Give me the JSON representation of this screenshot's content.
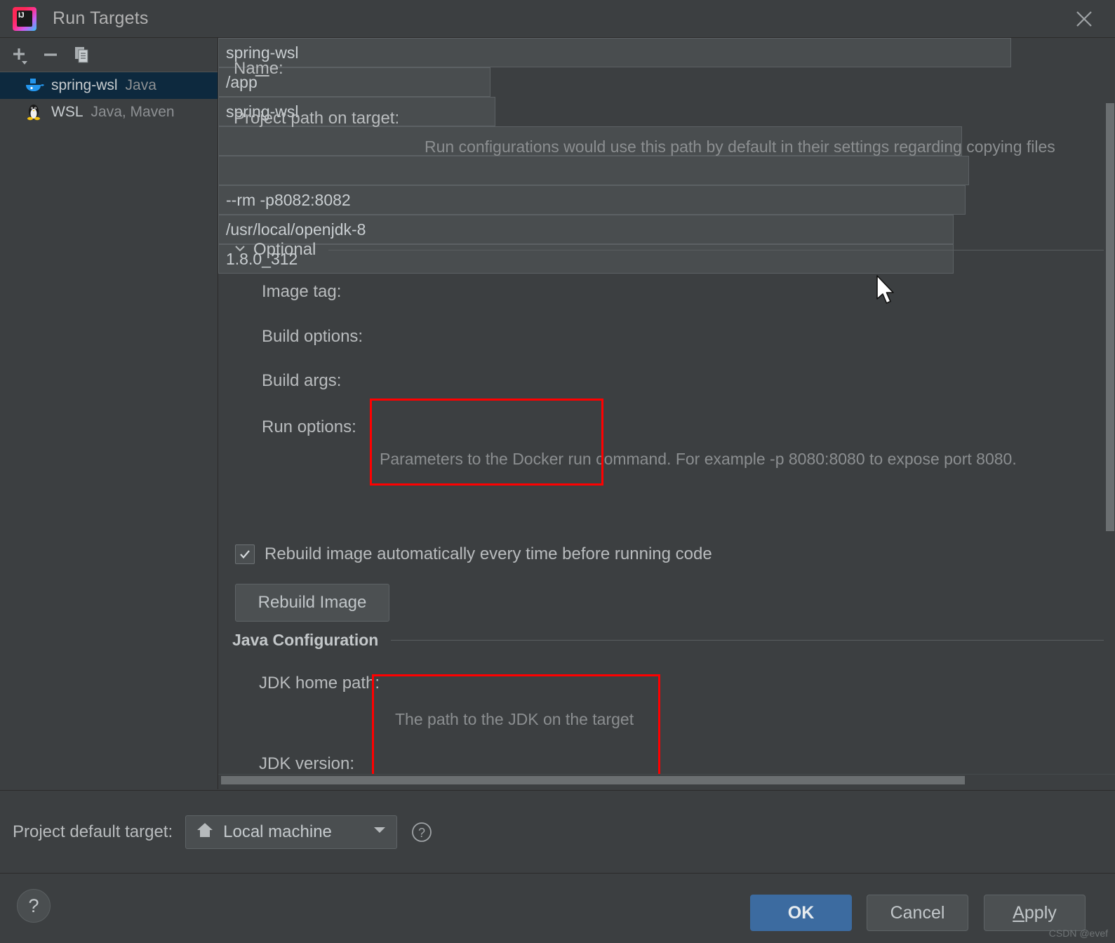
{
  "window": {
    "title": "Run Targets",
    "app_icon": "intellij-idea-icon",
    "close_icon": "close-icon"
  },
  "sidebar": {
    "toolbar": [
      {
        "name": "add-target-button",
        "icon": "plus-icon",
        "label": "+"
      },
      {
        "name": "remove-target-button",
        "icon": "minus-icon",
        "label": "−"
      },
      {
        "name": "copy-target-button",
        "icon": "copy-icon",
        "label": "Copy"
      }
    ],
    "items": [
      {
        "name": "spring-wsl",
        "sub": "Java",
        "icon": "docker-icon",
        "selected": true
      },
      {
        "name": "WSL",
        "sub": "Java, Maven",
        "icon": "linux-penguin-icon",
        "selected": false
      }
    ]
  },
  "form": {
    "name_label": "Na",
    "name_label_mnemonic": "m",
    "name_label_rest": "e:",
    "name_value": "spring-wsl",
    "project_path_label": "Project path on target:",
    "project_path_value": "/app",
    "project_path_hint": "Run configurations would use this path by default in their settings regarding copying files",
    "optional_section": "Optional",
    "image_tag_label": "Image tag:",
    "image_tag_value": "spring-wsl",
    "build_options_label": "Build options:",
    "build_options_value": "",
    "build_args_label": "Build args:",
    "build_args_value": "",
    "run_options_label": "Run options:",
    "run_options_value": "--rm  -p8082:8082",
    "run_options_hint": "Parameters to the Docker run command. For example -p 8080:8080 to expose port 8080.",
    "rebuild_checkbox_label": "Rebuild image automatically every time before running code",
    "rebuild_checkbox_checked": true,
    "rebuild_button_label": "Rebuild Image",
    "java_config_section": "Java Configuration",
    "jdk_home_label": "JDK home path:",
    "jdk_home_value": "/usr/local/openjdk-8",
    "jdk_home_hint": "The path to the JDK on the target",
    "jdk_version_label": "JDK version:",
    "jdk_version_value": "1.8.0_312"
  },
  "footer": {
    "default_target_label": "Project default target:",
    "default_target_value": "Local machine",
    "default_target_icon": "home-icon",
    "default_target_help_icon": "help-circle-icon",
    "help_button_label": "?",
    "ok_label": "OK",
    "cancel_label": "Cancel",
    "apply_label_mnemonic": "A",
    "apply_label_rest": "pply"
  },
  "watermark": "CSDN @evef",
  "colors": {
    "background": "#3c3f41",
    "field_background": "#494d4f",
    "selection": "#0d293e",
    "accent_primary": "#3c6ba0",
    "annotation_red": "#ff0000",
    "text": "#bbbbbb",
    "hint_text": "#8b8e90"
  }
}
